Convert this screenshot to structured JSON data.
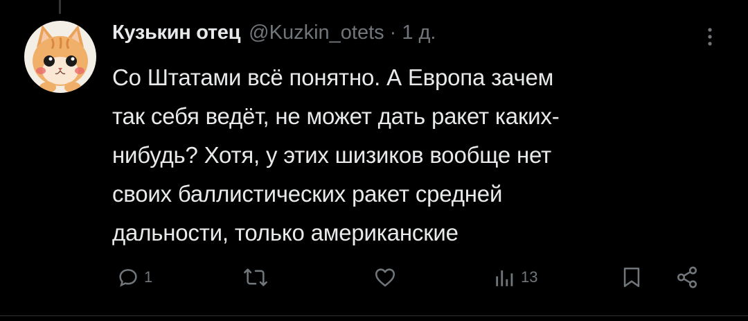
{
  "tweet": {
    "author_name": "Кузькин отец",
    "handle": "@Kuzkin_otets",
    "separator": "·",
    "time": "1 д.",
    "text": "Со Штатами всё понятно. А Европа зачем\nтак себя ведёт, не может дать ракет каких-\nнибудь? Хотя, у этих шизиков вообще нет\nсвоих баллистических ракет средней\nдальности, только американские",
    "avatar_icon": "kitten-avatar"
  },
  "actions": {
    "reply": {
      "icon": "reply-icon",
      "count": "1"
    },
    "retweet": {
      "icon": "retweet-icon",
      "count": ""
    },
    "like": {
      "icon": "heart-icon",
      "count": ""
    },
    "views": {
      "icon": "views-icon",
      "count": "13"
    },
    "bookmark": {
      "icon": "bookmark-icon"
    },
    "share": {
      "icon": "share-icon"
    }
  },
  "colors": {
    "background": "#000000",
    "primary_text": "#e7e9ea",
    "secondary_text": "#71767b",
    "divider": "#2f3336"
  }
}
